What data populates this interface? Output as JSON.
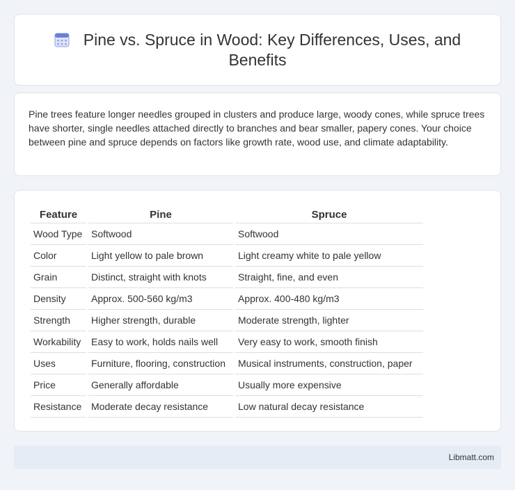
{
  "header": {
    "icon": "calendar-icon",
    "title": "Pine vs. Spruce in Wood: Key Differences, Uses, and Benefits"
  },
  "summary": {
    "text": "Pine trees feature longer needles grouped in clusters and produce large, woody cones, while spruce trees have shorter, single needles attached directly to branches and bear smaller, papery cones. Your choice between pine and spruce depends on factors like growth rate, wood use, and climate adaptability."
  },
  "table": {
    "headers": [
      "Feature",
      "Pine",
      "Spruce"
    ],
    "rows": [
      [
        "Wood Type",
        "Softwood",
        "Softwood"
      ],
      [
        "Color",
        "Light yellow to pale brown",
        "Light creamy white to pale yellow"
      ],
      [
        "Grain",
        "Distinct, straight with knots",
        "Straight, fine, and even"
      ],
      [
        "Density",
        "Approx. 500-560 kg/m3",
        "Approx. 400-480 kg/m3"
      ],
      [
        "Strength",
        "Higher strength, durable",
        "Moderate strength, lighter"
      ],
      [
        "Workability",
        "Easy to work, holds nails well",
        "Very easy to work, smooth finish"
      ],
      [
        "Uses",
        "Furniture, flooring, construction",
        "Musical instruments, construction, paper"
      ],
      [
        "Price",
        "Generally affordable",
        "Usually more expensive"
      ],
      [
        "Resistance",
        "Moderate decay resistance",
        "Low natural decay resistance"
      ]
    ]
  },
  "footer": {
    "text": "Libmatt.com"
  },
  "colors": {
    "background": "#f0f3f8",
    "card": "#ffffff",
    "footer": "#e6ecf6",
    "icon_accent": "#6b7fd7"
  }
}
